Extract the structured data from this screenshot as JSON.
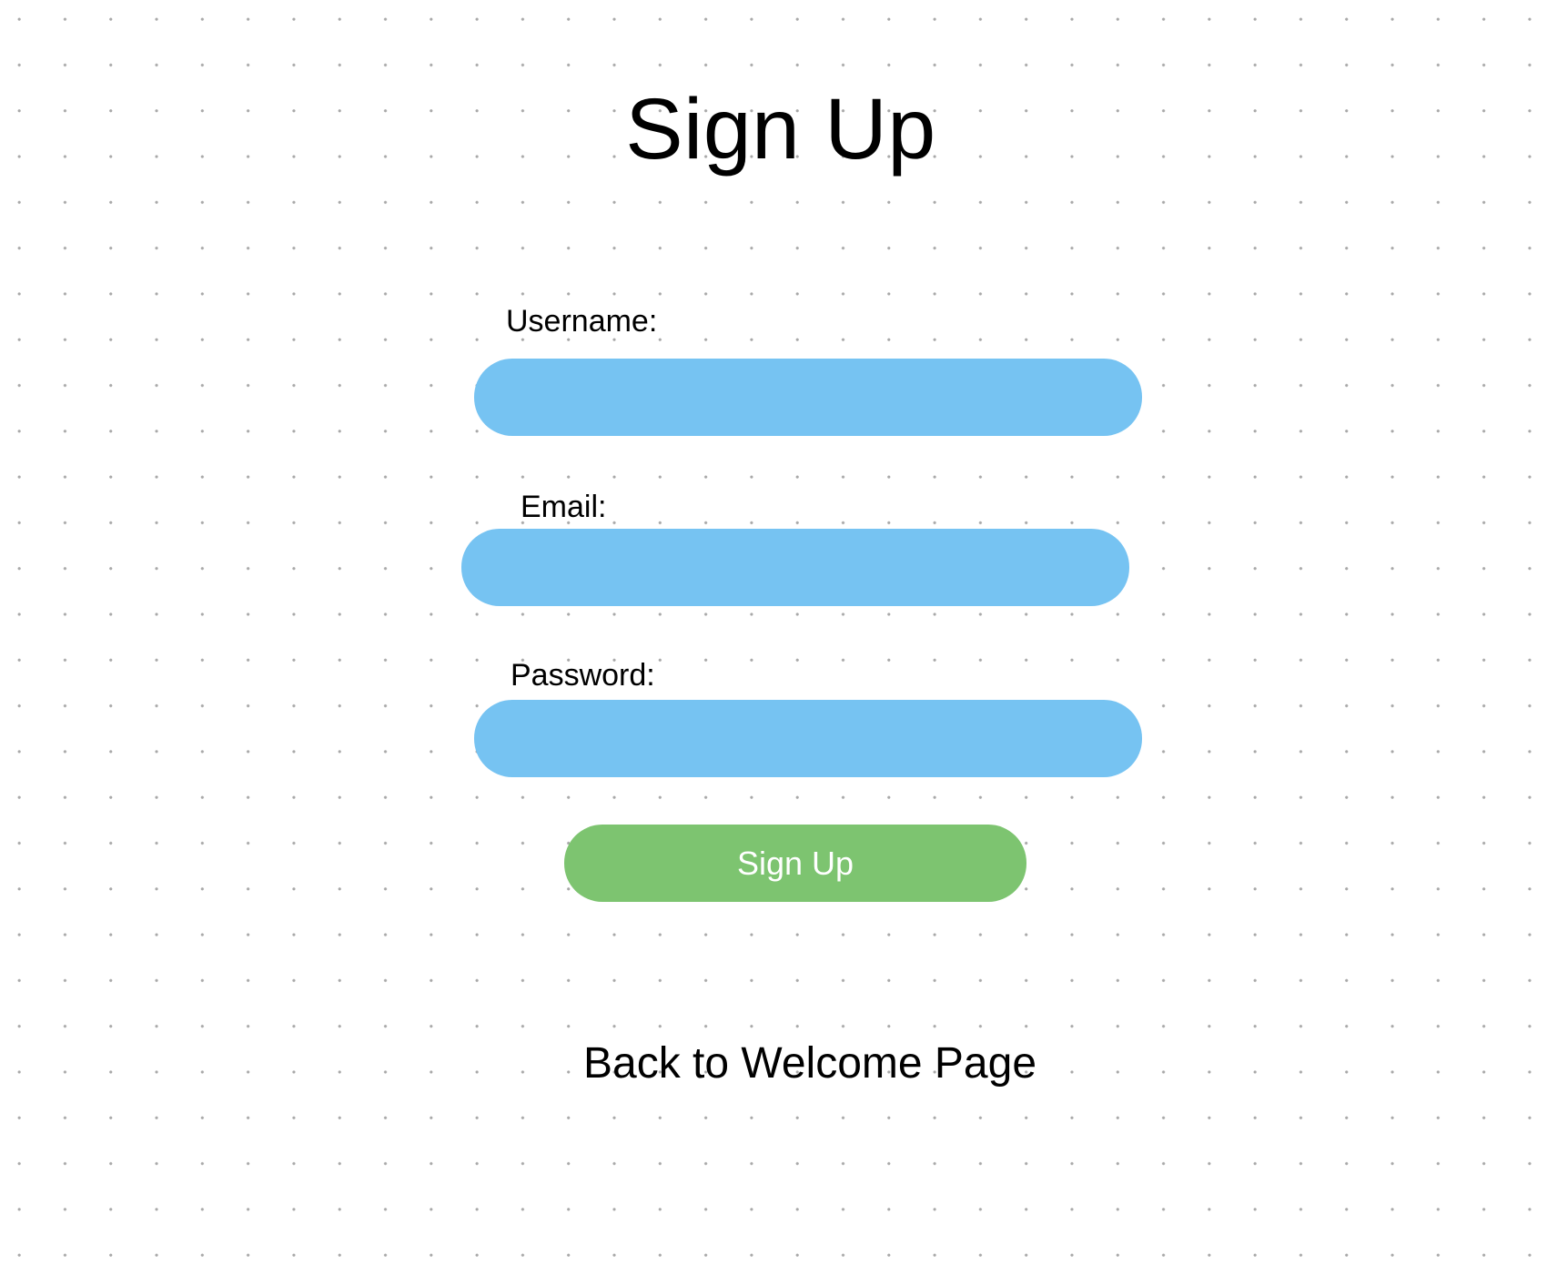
{
  "page": {
    "title": "Sign Up"
  },
  "form": {
    "username": {
      "label": "Username:",
      "value": "",
      "placeholder": ""
    },
    "email": {
      "label": "Email:",
      "value": "",
      "placeholder": ""
    },
    "password": {
      "label": "Password:",
      "value": "",
      "placeholder": ""
    },
    "submit_label": "Sign Up"
  },
  "footer": {
    "back_link_label": "Back to Welcome Page"
  },
  "colors": {
    "input_background": "#76c3f2",
    "button_background": "#7dc470",
    "button_text": "#ffffff",
    "dot_grid": "#a8a8a8"
  }
}
